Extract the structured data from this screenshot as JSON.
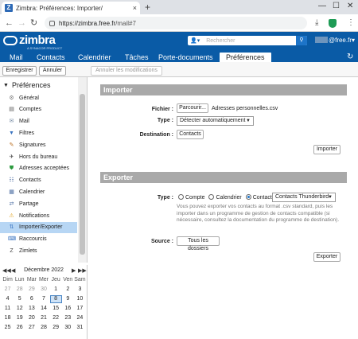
{
  "browser": {
    "tab_title": "Zimbra: Préférences: Importer/",
    "url_host": "https://zimbra.free.fr",
    "url_path": "/mail#7",
    "new_tab": "+",
    "close_tab": "×",
    "back": "←",
    "forward": "→",
    "reload": "↻"
  },
  "header": {
    "logo_name": "zimbra",
    "logo_sub": "A SYNACOR PRODUCT",
    "search_placeholder": "Rechercher",
    "search_scope_icon": "person-icon",
    "user_email": "@free.fr",
    "user_caret": "▾"
  },
  "app_tabs": [
    "Mail",
    "Contacts",
    "Calendrier",
    "Tâches",
    "Porte-documents",
    "Préférences"
  ],
  "toolbar": {
    "save": "Enregistrer",
    "cancel": "Annuler",
    "undo": "Annuler les modifications"
  },
  "tree": {
    "root": "Préférences",
    "items": [
      {
        "label": "Général",
        "icon": "gear-icon",
        "color": "#777777"
      },
      {
        "label": "Comptes",
        "icon": "account-icon",
        "color": "#555555"
      },
      {
        "label": "Mail",
        "icon": "mail-icon",
        "color": "#7a8fa6"
      },
      {
        "label": "Filtres",
        "icon": "filter-icon",
        "color": "#3a74c0"
      },
      {
        "label": "Signatures",
        "icon": "signature-icon",
        "color": "#b86b1d"
      },
      {
        "label": "Hors du bureau",
        "icon": "plane-icon",
        "color": "#444444"
      },
      {
        "label": "Adresses acceptées",
        "icon": "shield-icon",
        "color": "#2b9a3e"
      },
      {
        "label": "Contacts",
        "icon": "contacts-icon",
        "color": "#4c6ea3"
      },
      {
        "label": "Calendrier",
        "icon": "calendar-icon",
        "color": "#4c6ea3"
      },
      {
        "label": "Partage",
        "icon": "share-icon",
        "color": "#4c6ea3"
      },
      {
        "label": "Notifications",
        "icon": "bell-icon",
        "color": "#e0a01b"
      },
      {
        "label": "Importer/Exporter",
        "icon": "import-export-icon",
        "color": "#3a74c0"
      },
      {
        "label": "Raccourcis",
        "icon": "shortcut-icon",
        "color": "#3a74c0"
      },
      {
        "label": "Zimlets",
        "icon": "zimlet-icon",
        "color": "#444444"
      }
    ]
  },
  "calendar": {
    "title": "Décembre 2022",
    "prev_year": "◀◀",
    "prev": "◀",
    "next": "▶",
    "next_year": "▶▶",
    "days": [
      "Dim",
      "Lun",
      "Mar",
      "Mer",
      "Jeu",
      "Ven",
      "Sam"
    ],
    "rows": [
      [
        "27",
        "28",
        "29",
        "30",
        "1",
        "2",
        "3"
      ],
      [
        "4",
        "5",
        "6",
        "7",
        "8",
        "9",
        "10"
      ],
      [
        "11",
        "12",
        "13",
        "14",
        "15",
        "16",
        "17"
      ],
      [
        "18",
        "19",
        "20",
        "21",
        "22",
        "23",
        "24"
      ],
      [
        "25",
        "26",
        "27",
        "28",
        "29",
        "30",
        "31"
      ]
    ],
    "today": "8"
  },
  "import": {
    "header": "Importer",
    "file_label": "Fichier :",
    "browse": "Parcourir...",
    "file_name": "Adresses personnelles.csv",
    "type_label": "Type :",
    "type_value": "Détecter automatiquement",
    "destination_label": "Destination :",
    "destination_value": "Contacts",
    "import_button": "Importer"
  },
  "export": {
    "header": "Exporter",
    "type_label": "Type :",
    "opt_compte": "Compte",
    "opt_calendrier": "Calendrier",
    "opt_contacts": "Contacts",
    "contacts_format": "Contacts Thunderbird",
    "help": "Vous pouvez exporter vos contacts au format .csv standard, puis les importer dans un programme de gestion de contacts compatible (si nécessaire, consultez la documentation du programme de destination).",
    "source_label": "Source :",
    "source_value": "Tous les dossiers",
    "export_button": "Exporter"
  }
}
